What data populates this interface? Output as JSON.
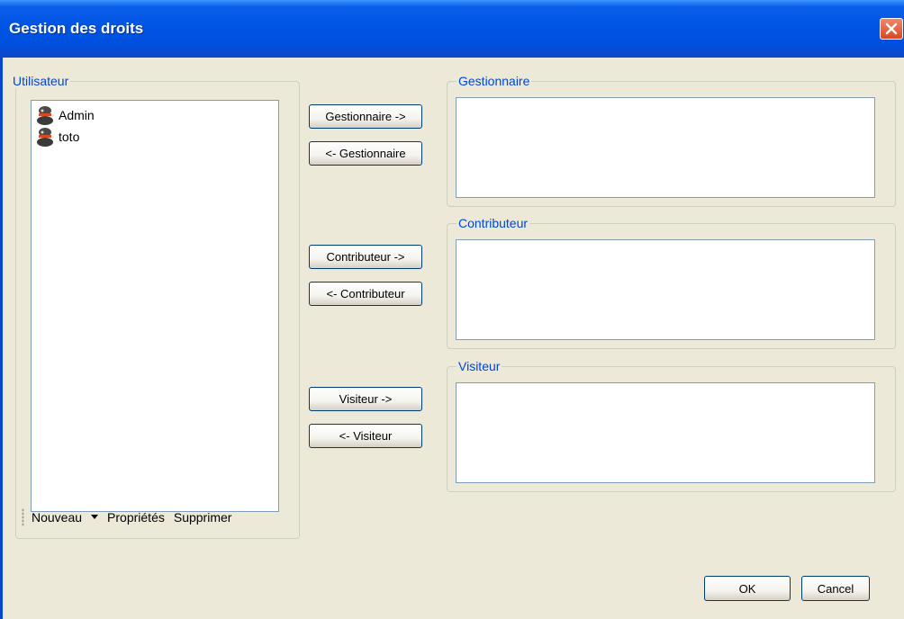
{
  "window": {
    "title": "Gestion des droits"
  },
  "user_group": {
    "legend": "Utilisateur",
    "users": [
      {
        "name": "Admin",
        "icon": "user-icon"
      },
      {
        "name": "toto",
        "icon": "user-icon"
      }
    ],
    "toolbar": {
      "new": "Nouveau",
      "properties": "Propriétés",
      "delete": "Supprimer"
    }
  },
  "roles": {
    "manager": {
      "legend": "Gestionnaire",
      "add": "Gestionnaire ->",
      "remove": "<- Gestionnaire"
    },
    "contributor": {
      "legend": "Contributeur",
      "add": "Contributeur ->",
      "remove": "<- Contributeur"
    },
    "visitor": {
      "legend": "Visiteur",
      "add": "Visiteur ->",
      "remove": "<- Visiteur"
    }
  },
  "footer": {
    "ok": "OK",
    "cancel": "Cancel"
  },
  "colors": {
    "accent": "#0046D5",
    "titlebar": "#0054E3",
    "background": "#ECE9D8",
    "close": "#D9471E"
  }
}
